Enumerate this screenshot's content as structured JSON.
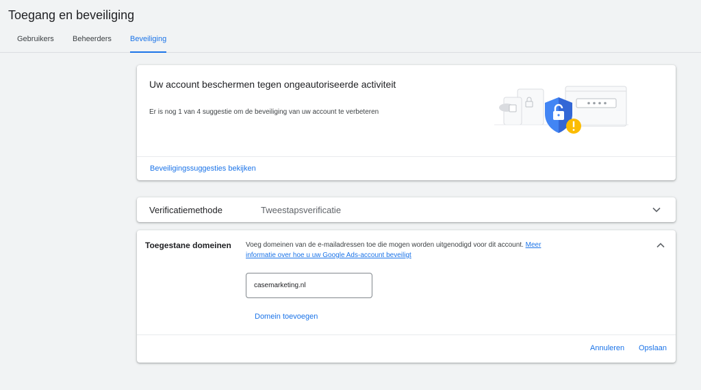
{
  "header": {
    "title": "Toegang en beveiliging",
    "tabs": [
      {
        "label": "Gebruikers",
        "active": false
      },
      {
        "label": "Beheerders",
        "active": false
      },
      {
        "label": "Beveiliging",
        "active": true
      }
    ]
  },
  "protect_card": {
    "title": "Uw account beschermen tegen ongeautoriseerde activiteit",
    "description": "Er is nog 1 van 4 suggestie om de beveiliging van uw account te verbeteren",
    "link": "Beveiligingssuggesties bekijken",
    "illustration": "security-shield-illustration"
  },
  "verification": {
    "label": "Verificatiemethode",
    "value": "Tweestapsverificatie",
    "icon": "chevron-down-icon"
  },
  "domains": {
    "label": "Toegestane domeinen",
    "description_line1": "Voeg domeinen van de e-mailadressen toe die mogen worden uitgenodigd voor dit account.",
    "link_line1": "Meer",
    "link_line2": "informatie over hoe u uw Google Ads-account beveiligt",
    "input_value": "casemarketing.nl",
    "add_button": "Domein toevoegen",
    "cancel_button": "Annuleren",
    "save_button": "Opslaan",
    "icon": "chevron-up-icon"
  },
  "colors": {
    "accent": "#1a73e8",
    "background": "#f1f3f4",
    "shield": "#4285f4",
    "warning": "#fbbc04"
  }
}
